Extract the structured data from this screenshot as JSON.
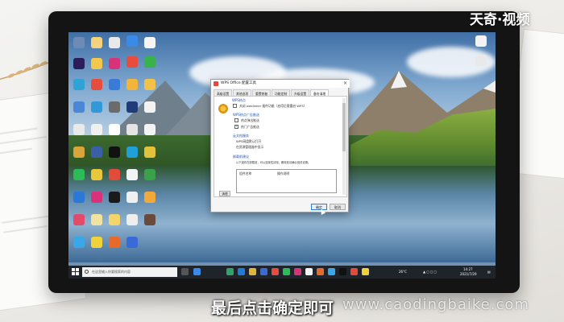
{
  "overlay": {
    "brand": "天奇·视频",
    "caption": "最后点击确定即可",
    "site": "www.caodingbaike.com"
  },
  "dialog": {
    "title": "WPS Office 配置工具",
    "close_label": "×",
    "tabs": [
      {
        "label": "高级设置"
      },
      {
        "label": "其他选项"
      },
      {
        "label": "重置修复"
      },
      {
        "label": "功能定制"
      },
      {
        "label": "升级设置"
      },
      {
        "label": "备份清理"
      }
    ],
    "section_heading": "WPS热点",
    "option_1": "关闭 weblinker 插件功能（启用后需重启 WPS）",
    "group_heading": "WPS热点广告推送",
    "option_2": "热点弹出推送",
    "option_3": "热门广告推送",
    "cloud_heading": "云文档服务",
    "cloud_text_1": "WPS网盘默认打开",
    "cloud_text_2": "在资源管理器中显示",
    "uninstall_heading": "卸载前建议",
    "uninstall_text": "以下组件在卸载前，可以选择性清除，删除前请确认相关设置。",
    "list_col_1": "组件名称",
    "list_col_2": "操作说明",
    "small_button": "清理",
    "ok_button": "确定",
    "cancel_button": "取消"
  },
  "taskbar": {
    "search_placeholder": "在这里输入你要搜索的内容",
    "weather": "26°C",
    "time": "14:27",
    "date": "2021/7/29"
  },
  "colors": {
    "accent": "#2c7cd6",
    "taskbar": "#1f232a"
  }
}
